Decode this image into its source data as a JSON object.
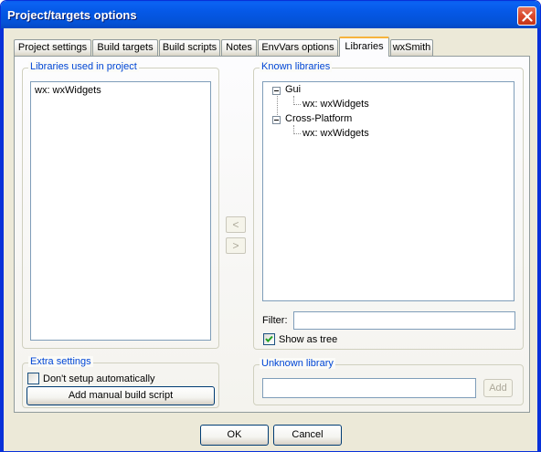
{
  "window": {
    "title": "Project/targets options"
  },
  "tabs": [
    {
      "label": "Project settings",
      "active": false
    },
    {
      "label": "Build targets",
      "active": false
    },
    {
      "label": "Build scripts",
      "active": false
    },
    {
      "label": "Notes",
      "active": false
    },
    {
      "label": "EnvVars options",
      "active": false
    },
    {
      "label": "Libraries",
      "active": true
    },
    {
      "label": "wxSmith",
      "active": false
    }
  ],
  "used_libraries": {
    "label": "Libraries used in project",
    "items": [
      "wx: wxWidgets"
    ]
  },
  "transfer": {
    "add_label": "<",
    "remove_label": ">"
  },
  "known_libraries": {
    "label": "Known libraries",
    "tree": [
      {
        "label": "Gui",
        "children": [
          "wx: wxWidgets"
        ]
      },
      {
        "label": "Cross-Platform",
        "children": [
          "wx: wxWidgets"
        ]
      }
    ],
    "filter_label": "Filter:",
    "filter_value": "",
    "show_as_tree_label": "Show as tree",
    "show_as_tree_checked": true
  },
  "extra_settings": {
    "label": "Extra settings",
    "dont_setup_label": "Don't setup automatically",
    "dont_setup_checked": false,
    "add_script_label": "Add manual build script"
  },
  "unknown_library": {
    "label": "Unknown library",
    "value": "",
    "add_label": "Add"
  },
  "footer": {
    "ok_label": "OK",
    "cancel_label": "Cancel"
  },
  "colors": {
    "title_bar": "#0558e6",
    "group_label": "#0046d5",
    "close_button": "#d9482b",
    "active_tab_accent": "#f7b33c",
    "dialog_face": "#ece9d8"
  }
}
